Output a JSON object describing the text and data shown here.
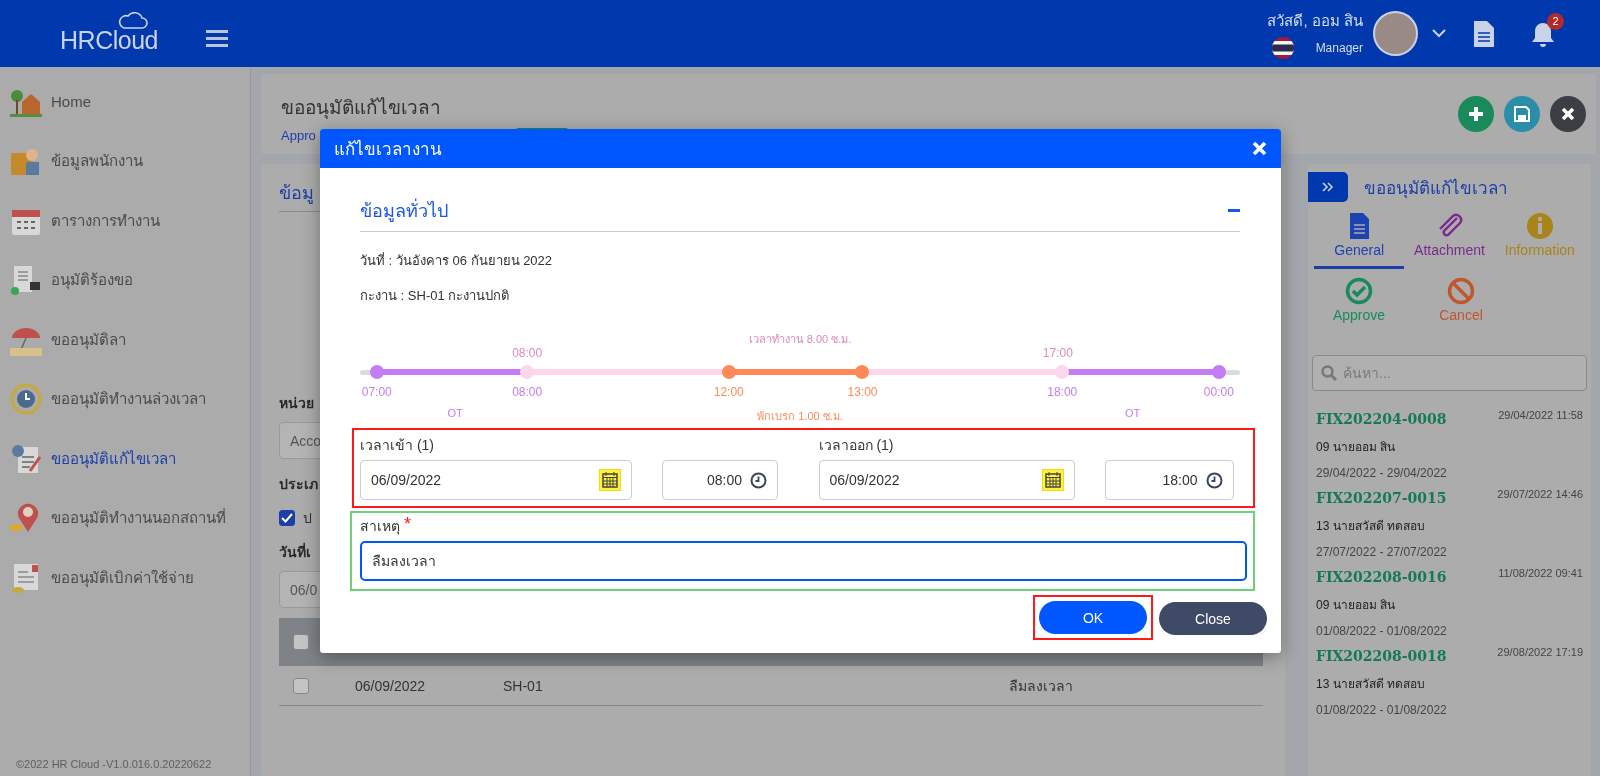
{
  "header": {
    "logo": "HRCloud",
    "greeting": "สวัสดี, ออม สิน",
    "role": "Manager",
    "notification_count": "2"
  },
  "sidebar": {
    "items": [
      {
        "label": "Home",
        "kind": "home",
        "selected": false
      },
      {
        "label": "ข้อมูลพนักงาน",
        "kind": "employee",
        "selected": false
      },
      {
        "label": "ตารางการทำงาน",
        "kind": "calendar",
        "selected": false
      },
      {
        "label": "อนุมัติร้องขอ",
        "kind": "approval",
        "selected": false
      },
      {
        "label": "ขออนุมัติลา",
        "kind": "leave",
        "selected": false
      },
      {
        "label": "ขออนุมัติทำงานล่วงเวลา",
        "kind": "overtime",
        "selected": false
      },
      {
        "label": "ขออนุมัติแก้ไขเวลา",
        "kind": "timefix",
        "selected": true
      },
      {
        "label": "ขออนุมัติทำงานนอกสถานที่",
        "kind": "location",
        "selected": false
      },
      {
        "label": "ขออนุมัติเบิกค่าใช้จ่าย",
        "kind": "expense",
        "selected": false
      }
    ],
    "footer": "©2022 HR Cloud -V1.0.016.0.20220622"
  },
  "page": {
    "title": "ขออนุมัติแก้ไขเวลา",
    "breadcrumb": "Appro"
  },
  "form": {
    "section": "ข้อมู",
    "unit_label": "หน่วย",
    "unit_value": "Acco",
    "type_label": "ประเภ",
    "type_option": {
      "label": "ป",
      "checked": true
    },
    "date_label": "วันที่เ",
    "date_value": "06/0"
  },
  "table": {
    "header_checked": false,
    "rows": [
      {
        "checked": false,
        "cells": [
          "06/09/2022",
          "SH-01",
          "ลืมลงเวลา"
        ]
      }
    ]
  },
  "modal": {
    "title": "แก้ไขเวลางาน",
    "section_title": "ข้อมูลทั่วไป",
    "date_line": "วันที่ : วันอังคาร 06 กันยายน 2022",
    "shift_line": "กะงาน : SH-01 กะงานปกติ",
    "timeline": {
      "work_label": "เวลาทำงาน 8.00 ซ.ม.",
      "shift_marks": [
        "08:00",
        "17:00"
      ],
      "points": [
        {
          "label": "07:00",
          "kind": "ot"
        },
        {
          "label": "08:00",
          "kind": "shift"
        },
        {
          "label": "12:00",
          "kind": "break"
        },
        {
          "label": "13:00",
          "kind": "break"
        },
        {
          "label": "18:00",
          "kind": "shift"
        },
        {
          "label": "00:00",
          "kind": "ot"
        }
      ],
      "spans": [
        {
          "label": "OT",
          "kind": "ot"
        },
        {
          "label": "พักเบรก 1.00 ซ.ม.",
          "kind": "break"
        },
        {
          "label": "OT",
          "kind": "ot"
        }
      ]
    },
    "time_in": {
      "label": "เวลาเข้า (1)",
      "date": "06/09/2022",
      "time": "08:00"
    },
    "time_out": {
      "label": "เวลาออก (1)",
      "date": "06/09/2022",
      "time": "18:00"
    },
    "reason": {
      "label": "สาเหตุ",
      "required_mark": "*",
      "value": "ลืมลงเวลา"
    },
    "buttons": [
      {
        "label": "OK",
        "kind": "primary"
      },
      {
        "label": "Close",
        "kind": "secondary"
      }
    ]
  },
  "right_panel": {
    "title": "ขออนุมัติแก้ไขเวลา",
    "tabs": [
      {
        "label": "General",
        "kind": "document",
        "selected": true
      },
      {
        "label": "Attachment",
        "kind": "attachment",
        "selected": false
      },
      {
        "label": "Information",
        "kind": "info",
        "selected": false
      }
    ],
    "actions": [
      {
        "label": "Approve",
        "kind": "approve"
      },
      {
        "label": "Cancel",
        "kind": "cancel"
      }
    ],
    "search": {
      "placeholder": "ค้นหา..."
    },
    "requests": [
      {
        "code": "FIX202204-0008",
        "timestamp": "29/04/2022 11:58",
        "employee": "09 นายออม สิน",
        "period": "29/04/2022 - 29/04/2022"
      },
      {
        "code": "FIX202207-0015",
        "timestamp": "29/07/2022 14:46",
        "employee": "13 นายสวัสดี ทดสอบ",
        "period": "27/07/2022 - 27/07/2022"
      },
      {
        "code": "FIX202208-0016",
        "timestamp": "11/08/2022 09:41",
        "employee": "09 นายออม สิน",
        "period": "01/08/2022 - 01/08/2022"
      },
      {
        "code": "FIX202208-0018",
        "timestamp": "29/08/2022 17:19",
        "employee": "13 นายสวัสดี ทดสอบ",
        "period": "01/08/2022 - 01/08/2022"
      }
    ]
  }
}
